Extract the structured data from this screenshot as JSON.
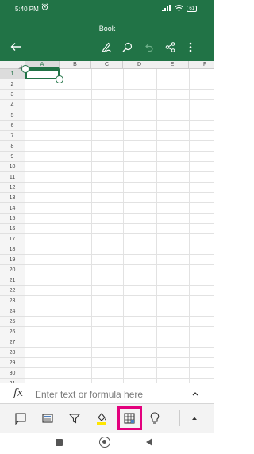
{
  "status_bar": {
    "time": "5:40 PM",
    "battery": "61"
  },
  "header": {
    "title": "Book"
  },
  "grid": {
    "columns": [
      "A",
      "B",
      "C",
      "D",
      "E",
      "F"
    ],
    "rows": [
      "1",
      "2",
      "3",
      "4",
      "5",
      "6",
      "7",
      "8",
      "9",
      "10",
      "11",
      "12",
      "13",
      "14",
      "15",
      "16",
      "17",
      "18",
      "19",
      "20",
      "21",
      "22",
      "23",
      "24",
      "25",
      "26",
      "27",
      "28",
      "29",
      "30",
      "31"
    ],
    "selected_cell": "A1"
  },
  "formula_bar": {
    "fx_label": "fx",
    "placeholder": "Enter text or formula here",
    "value": ""
  },
  "toolbar": {
    "items": [
      "comment-icon",
      "card-view-icon",
      "filter-icon",
      "fill-color-icon",
      "table-format-icon",
      "lightbulb-icon",
      "chevron-up-icon"
    ],
    "highlighted_item": "table-format-icon"
  },
  "colors": {
    "brand_green": "#217346",
    "highlight_magenta": "#e3007d",
    "fill_yellow": "#ffe600"
  }
}
